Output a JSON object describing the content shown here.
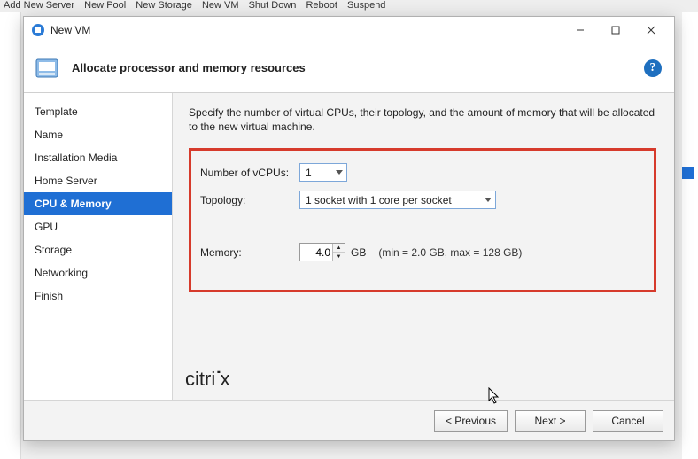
{
  "bg_toolbar": {
    "items": [
      "Add New Server",
      "New Pool",
      "New Storage",
      "New VM",
      "Shut Down",
      "Reboot",
      "Suspend"
    ]
  },
  "window": {
    "title": "New VM",
    "header_title": "Allocate processor and memory resources"
  },
  "sidebar": {
    "items": [
      {
        "label": "Template"
      },
      {
        "label": "Name"
      },
      {
        "label": "Installation Media"
      },
      {
        "label": "Home Server"
      },
      {
        "label": "CPU & Memory"
      },
      {
        "label": "GPU"
      },
      {
        "label": "Storage"
      },
      {
        "label": "Networking"
      },
      {
        "label": "Finish"
      }
    ],
    "selected_index": 4
  },
  "content": {
    "description": "Specify the number of virtual CPUs, their topology, and the amount of memory that will be allocated to the new virtual machine.",
    "vcpu_label": "Number of vCPUs:",
    "vcpu_value": "1",
    "topology_label": "Topology:",
    "topology_value": "1 socket with 1 core per socket",
    "memory_label": "Memory:",
    "memory_value": "4.0",
    "memory_unit": "GB",
    "memory_hint": "(min = 2.0 GB, max = 128 GB)"
  },
  "brand": "citrix",
  "footer": {
    "previous": "< Previous",
    "next": "Next >",
    "cancel": "Cancel"
  }
}
